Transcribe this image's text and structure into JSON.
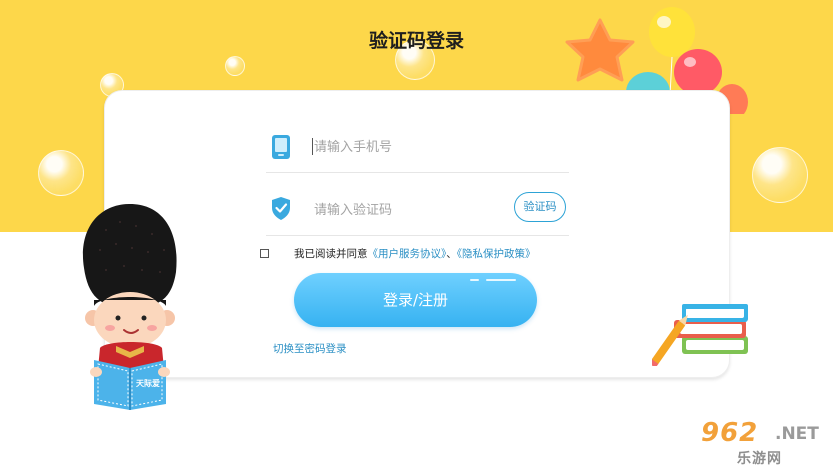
{
  "page": {
    "title": "验证码登录"
  },
  "form": {
    "phone_placeholder": "请输入手机号",
    "code_placeholder": "请输入验证码",
    "get_code_label": "验证码",
    "agree_prefix": "我已阅读并同意",
    "user_agreement": "《用户服务协议》",
    "separator": "、",
    "privacy_policy": "《隐私保护政策》",
    "login_label": "登录/注册",
    "switch_label": "切换至密码登录"
  },
  "decor": {
    "book_label": "天际爱"
  },
  "watermark": {
    "top": "962",
    "net": ".NET",
    "bottom": "乐游网"
  },
  "colors": {
    "background_top": "#fdd74a",
    "accent_blue": "#2a8fc4",
    "button_gradient_top": "#6fd0ff",
    "button_gradient_bottom": "#36b2f1"
  }
}
